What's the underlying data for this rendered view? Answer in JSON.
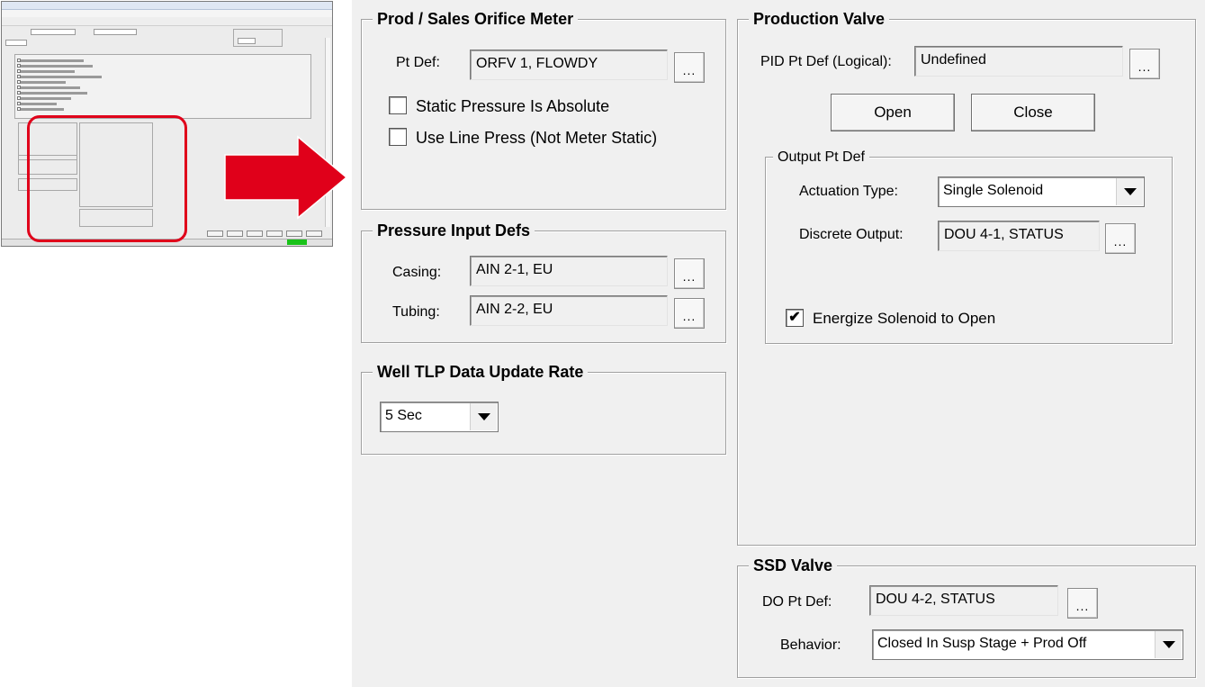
{
  "colors": {
    "highlight": "#e0001a",
    "arrow": "#e0001a",
    "status_ok": "#19c219",
    "panel_bg": "#f0f0f0"
  },
  "prod_meter": {
    "title": "Prod / Sales Orifice Meter",
    "pt_def_label": "Pt Def:",
    "pt_def_value": "ORFV 1, FLOWDY",
    "browse_label": "...",
    "static_abs_label": "Static Pressure Is Absolute",
    "static_abs_checked": false,
    "line_press_label": "Use Line Press (Not Meter Static)",
    "line_press_checked": false
  },
  "pressure_inputs": {
    "title": "Pressure Input Defs",
    "casing_label": "Casing:",
    "casing_value": "AIN 2-1, EU",
    "tubing_label": "Tubing:",
    "tubing_value": "AIN 2-2, EU",
    "browse_label": "..."
  },
  "update_rate": {
    "title": "Well TLP Data Update Rate",
    "selected": "5 Sec"
  },
  "production_valve": {
    "title": "Production Valve",
    "pid_label": "PID Pt Def (Logical):",
    "pid_value": "Undefined",
    "browse_label": "...",
    "open_label": "Open",
    "close_label": "Close",
    "output": {
      "title": "Output Pt Def",
      "actuation_label": "Actuation Type:",
      "actuation_value": "Single Solenoid",
      "discrete_label": "Discrete Output:",
      "discrete_value": "DOU 4-1, STATUS",
      "energize_label": "Energize Solenoid to Open",
      "energize_checked": true,
      "check_mark": "✔"
    }
  },
  "ssd_valve": {
    "title": "SSD Valve",
    "do_label": "DO Pt Def:",
    "do_value": "DOU 4-2, STATUS",
    "browse_label": "...",
    "behavior_label": "Behavior:",
    "behavior_value": "Closed In Susp Stage + Prod Off"
  }
}
